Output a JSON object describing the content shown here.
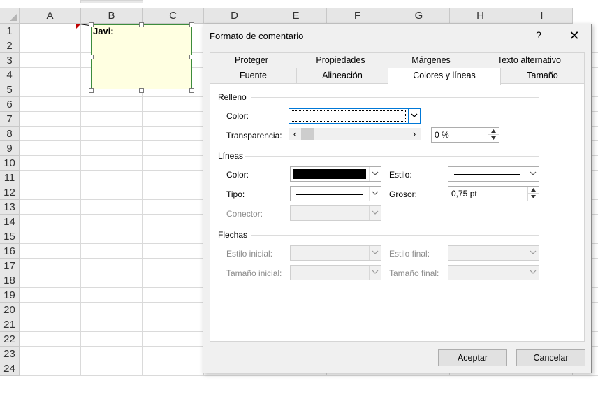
{
  "sheet": {
    "columns": [
      "A",
      "B",
      "C",
      "D",
      "E",
      "F",
      "G",
      "H",
      "I"
    ],
    "rows": [
      "1",
      "2",
      "3",
      "4",
      "5",
      "6",
      "7",
      "8",
      "9",
      "10",
      "11",
      "12",
      "13",
      "14",
      "15",
      "16",
      "17",
      "18",
      "19",
      "20",
      "21",
      "22",
      "23",
      "24"
    ],
    "comment_author": "Javi:"
  },
  "dialog": {
    "title": "Formato de comentario",
    "help": "?",
    "close": "✕",
    "tabs_back": [
      "Proteger",
      "Propiedades",
      "Márgenes",
      "Texto alternativo"
    ],
    "tabs_front": [
      "Fuente",
      "Alineación",
      "Colores y líneas",
      "Tamaño"
    ],
    "active_tab": "Colores y líneas",
    "fill": {
      "group": "Relleno",
      "color_label": "Color:",
      "transparency_label": "Transparencia:",
      "transparency_value": "0 %"
    },
    "lines": {
      "group": "Líneas",
      "color_label": "Color:",
      "style_label": "Estilo:",
      "type_label": "Tipo:",
      "weight_label": "Grosor:",
      "weight_value": "0,75 pt",
      "connector_label": "Conector:"
    },
    "arrows": {
      "group": "Flechas",
      "start_style_label": "Estilo inicial:",
      "end_style_label": "Estilo final:",
      "start_size_label": "Tamaño inicial:",
      "end_size_label": "Tamaño final:"
    },
    "ok": "Aceptar",
    "cancel": "Cancelar"
  },
  "colors": {
    "accent": "#0078d7",
    "comment_fill": "#ffffe1",
    "comment_border": "#3c8c3c",
    "selected_header": "#217346"
  }
}
